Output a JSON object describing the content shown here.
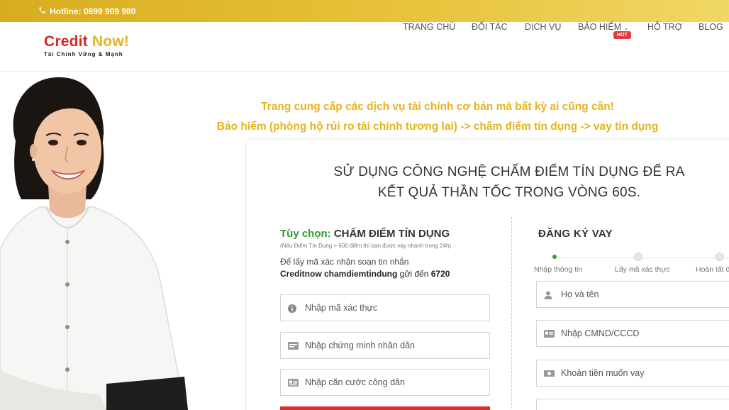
{
  "topbar": {
    "hotline": "Hotline: 0899 909 980",
    "phone_icon": "phone-icon"
  },
  "brand": {
    "logo_part1": "Credit ",
    "logo_part2": "Now!",
    "tagline": "Tài Chính Vững & Mạnh"
  },
  "nav": {
    "items": [
      "TRANG CHỦ",
      "ĐỐI TÁC",
      "DỊCH VỤ",
      "BẢO HIỂM",
      "HỖ TRỢ",
      "BLOG"
    ],
    "hot_badge": "HOT"
  },
  "hero": {
    "line1": "Trang cung cấp các dịch vụ tài chính cơ bản mà bất kỳ ai cũng cần!",
    "line2": "Bảo hiểm (phòng hộ rủi ro tài chính tương lai) -> chấm điểm tín dụng -> vay tín dụng"
  },
  "card": {
    "title1": "SỬ DỤNG CÔNG NGHỆ CHẤM ĐIỂM TÍN DỤNG ĐỂ RA",
    "title2": "KẾT QUẢ THẦN TỐC TRONG VÒNG 60S."
  },
  "score": {
    "option_label": "Tùy chọn:",
    "option_title": " CHẤM ĐIỂM TÍN DỤNG",
    "note": "(Nếu Điểm Tín Dụng > 600 điểm thì bạn được vay nhanh trong 24h)",
    "sms_line1": "Để lấy mã xác nhận soạn tin nhắn",
    "sms_code": "Creditnow chamdiemtindung",
    "sms_to": " gửi đến ",
    "sms_number": "6720",
    "fields": [
      "Nhập mã xác thực",
      "Nhập chứng minh nhân dân",
      "Nhập căn cước công dân"
    ]
  },
  "register": {
    "title": "ĐĂNG KÝ VAY",
    "steps": [
      "Nhập thông tin",
      "Lấy mã xác thực",
      "Hoàn tất đ"
    ],
    "active_step": 1,
    "fields": [
      "Họ và tên",
      "Nhập CMND/CCCD",
      "Khoản tiền muốn vay"
    ]
  },
  "colors": {
    "accent": "#e6b41e",
    "brand_red": "#d42a20",
    "green": "#2e9a32",
    "submit": "#e02a22"
  }
}
